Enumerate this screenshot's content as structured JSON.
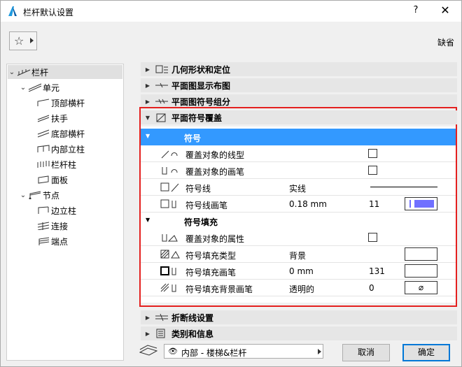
{
  "window": {
    "title": "栏杆默认设置",
    "help_label": "?",
    "close_label": "✕"
  },
  "toolbar": {
    "favorites_icon": "star-icon",
    "default_label": "缺省"
  },
  "tree": {
    "items": [
      {
        "label": "栏杆",
        "level": 0,
        "expanded": true,
        "selected": true
      },
      {
        "label": "单元",
        "level": 1,
        "expanded": true
      },
      {
        "label": "顶部横杆",
        "level": 2
      },
      {
        "label": "扶手",
        "level": 2
      },
      {
        "label": "底部横杆",
        "level": 2
      },
      {
        "label": "内部立柱",
        "level": 2
      },
      {
        "label": "栏杆柱",
        "level": 2
      },
      {
        "label": "面板",
        "level": 2
      },
      {
        "label": "节点",
        "level": 1,
        "expanded": true
      },
      {
        "label": "边立柱",
        "level": 2
      },
      {
        "label": "连接",
        "level": 2
      },
      {
        "label": "端点",
        "level": 2
      }
    ]
  },
  "sections": {
    "geometry": "几何形状和定位",
    "floor_plan_display": "平面图显示布图",
    "floor_plan_symbol": "平面图符号组分",
    "symbol_override": "平面符号覆盖",
    "break_line": "折断线设置",
    "category": "类别和信息"
  },
  "override_panel": {
    "symbol_group": {
      "label": "符号",
      "rows": [
        {
          "label": "覆盖对象的线型",
          "value": "",
          "number": "",
          "checkbox": true
        },
        {
          "label": "覆盖对象的画笔",
          "value": "",
          "number": "",
          "checkbox": true
        },
        {
          "label": "符号线",
          "value": "实线",
          "number": "",
          "line_sample": true
        },
        {
          "label": "符号线画笔",
          "value": "0.18 mm",
          "number": "11",
          "pen_color": "#7070ff"
        }
      ]
    },
    "fill_group": {
      "label": "符号填充",
      "rows": [
        {
          "label": "覆盖对象的属性",
          "value": "",
          "number": "",
          "checkbox": true
        },
        {
          "label": "符号填充类型",
          "value": "背景",
          "number": ""
        },
        {
          "label": "符号填充画笔",
          "value": "0 mm",
          "number": "131"
        },
        {
          "label": "符号填充背景画笔",
          "value": "透明的",
          "number": "0",
          "swatch_text": "⌀"
        }
      ]
    }
  },
  "footer": {
    "view_label": "内部 - 楼梯&栏杆",
    "cancel_label": "取消",
    "ok_label": "确定"
  },
  "colors": {
    "selection": "#3399ff",
    "highlight_border": "#e4201f",
    "pen_fill": "#7070ff"
  }
}
